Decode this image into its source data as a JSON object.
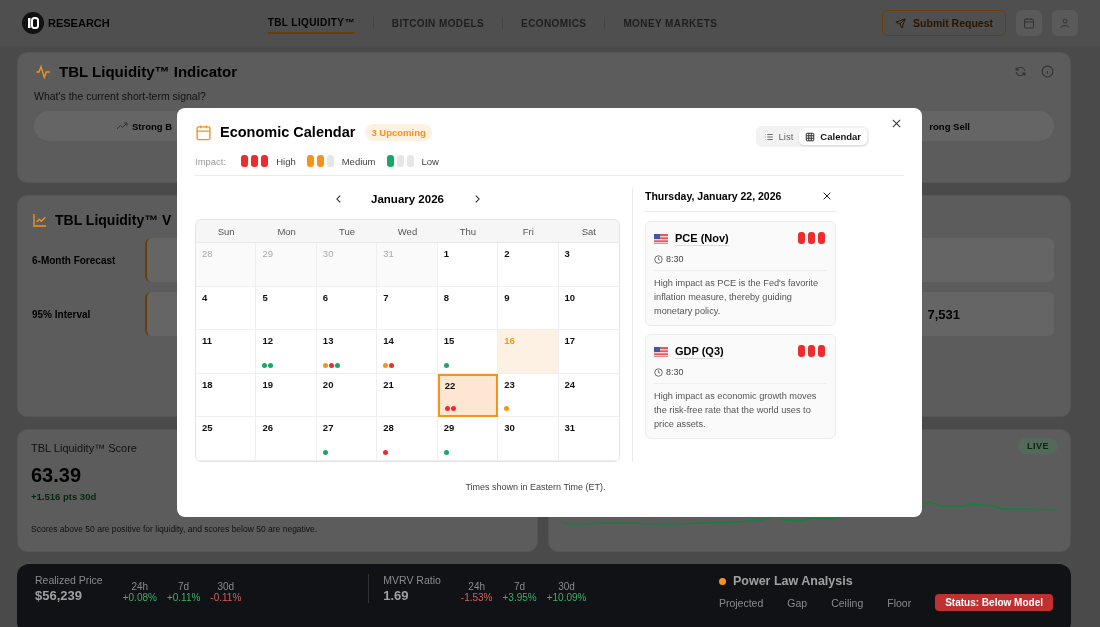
{
  "header": {
    "logo": "RESEARCH",
    "nav": [
      {
        "label": "TBL LIQUIDITY™",
        "selected": true
      },
      {
        "label": "BITCOIN MODELS",
        "selected": false
      },
      {
        "label": "ECONOMICS",
        "selected": false
      },
      {
        "label": "MONEY MARKETS",
        "selected": false
      }
    ],
    "submit": "Submit Request"
  },
  "indicator": {
    "title": "TBL Liquidity™ Indicator",
    "question": "What's the current short-term signal?",
    "signal_left": "Strong B",
    "signal_right": "rong Sell"
  },
  "forecast": {
    "title": "TBL Liquidity™ V",
    "rows": [
      {
        "label": "6-Month Forecast"
      },
      {
        "label": "95% Interval",
        "value": "7,531"
      }
    ]
  },
  "score": {
    "title": "TBL Liquidity™ Score",
    "value": "63.39",
    "change": "+1.516 pts 30d",
    "note": "Scores above 50 are positive for liquidity, and scores below 50 are negative."
  },
  "live": {
    "badge": "LIVE"
  },
  "metrics": [
    {
      "label": "Realized Price",
      "value": "$56,239",
      "periods": [
        {
          "label": "24h",
          "change": "+0.08%",
          "kind": "up"
        },
        {
          "label": "7d",
          "change": "+0.11%",
          "kind": "up"
        },
        {
          "label": "30d",
          "change": "-0.11%",
          "kind": "down"
        }
      ]
    },
    {
      "label": "MVRV Ratio",
      "value": "1.69",
      "periods": [
        {
          "label": "24h",
          "change": "-1.53%",
          "kind": "down"
        },
        {
          "label": "7d",
          "change": "+3.95%",
          "kind": "up"
        },
        {
          "label": "30d",
          "change": "+10.09%",
          "kind": "up"
        }
      ]
    }
  ],
  "power_law": {
    "title": "Power Law Analysis",
    "columns": [
      "Projected",
      "Gap",
      "Ceiling",
      "Floor"
    ],
    "status": "Status: Below Model"
  },
  "calendar_modal": {
    "title": "Economic Calendar",
    "badge": "3 Upcoming",
    "views": [
      {
        "label": "List",
        "selected": false
      },
      {
        "label": "Calendar",
        "selected": true
      }
    ],
    "impact_label": "Impact:",
    "legend": [
      {
        "kind": "high",
        "label": "High",
        "color": "#ef2b2d"
      },
      {
        "kind": "medium",
        "label": "Medium",
        "color": "#f7931a"
      },
      {
        "kind": "low",
        "label": "Low",
        "color": "#16a864"
      }
    ],
    "month": "January 2026",
    "weekdays": [
      "Sun",
      "Mon",
      "Tue",
      "Wed",
      "Thu",
      "Fri",
      "Sat"
    ],
    "weeks": [
      [
        {
          "day": "28",
          "outside": true,
          "today": false,
          "selected": false
        },
        {
          "day": "29",
          "outside": true,
          "today": false,
          "selected": false
        },
        {
          "day": "30",
          "outside": true,
          "today": false,
          "selected": false
        },
        {
          "day": "31",
          "outside": true,
          "today": false,
          "selected": false
        },
        {
          "day": "1",
          "outside": false,
          "today": false,
          "selected": false
        },
        {
          "day": "2",
          "outside": false,
          "today": false,
          "selected": false
        },
        {
          "day": "3",
          "outside": false,
          "today": false,
          "selected": false
        }
      ],
      [
        {
          "day": "4",
          "outside": false,
          "today": false,
          "selected": false
        },
        {
          "day": "5",
          "outside": false,
          "today": false,
          "selected": false
        },
        {
          "day": "6",
          "outside": false,
          "today": false,
          "selected": false
        },
        {
          "day": "7",
          "outside": false,
          "today": false,
          "selected": false
        },
        {
          "day": "8",
          "outside": false,
          "today": false,
          "selected": false
        },
        {
          "day": "9",
          "outside": false,
          "today": false,
          "selected": false
        },
        {
          "day": "10",
          "outside": false,
          "today": false,
          "selected": false
        }
      ],
      [
        {
          "day": "11",
          "outside": false,
          "today": false,
          "selected": false
        },
        {
          "day": "12",
          "outside": false,
          "today": false,
          "selected": false,
          "dots": [
            {
              "color": "#16a864"
            },
            {
              "color": "#16a864"
            }
          ]
        },
        {
          "day": "13",
          "outside": false,
          "today": false,
          "selected": false,
          "dots": [
            {
              "color": "#f7931a"
            },
            {
              "color": "#ef2b2d"
            },
            {
              "color": "#16a864"
            }
          ]
        },
        {
          "day": "14",
          "outside": false,
          "today": false,
          "selected": false,
          "dots": [
            {
              "color": "#f7931a"
            },
            {
              "color": "#ef2b2d"
            }
          ]
        },
        {
          "day": "15",
          "outside": false,
          "today": false,
          "selected": false,
          "dots": [
            {
              "color": "#16a864"
            }
          ]
        },
        {
          "day": "16",
          "outside": false,
          "today": true,
          "selected": false
        },
        {
          "day": "17",
          "outside": false,
          "today": false,
          "selected": false
        }
      ],
      [
        {
          "day": "18",
          "outside": false,
          "today": false,
          "selected": false
        },
        {
          "day": "19",
          "outside": false,
          "today": false,
          "selected": false
        },
        {
          "day": "20",
          "outside": false,
          "today": false,
          "selected": false
        },
        {
          "day": "21",
          "outside": false,
          "today": false,
          "selected": false
        },
        {
          "day": "22",
          "outside": false,
          "today": false,
          "selected": true,
          "dots": [
            {
              "color": "#ef2b2d"
            },
            {
              "color": "#ef2b2d"
            }
          ]
        },
        {
          "day": "23",
          "outside": false,
          "today": false,
          "selected": false,
          "dots": [
            {
              "color": "#f7931a"
            }
          ]
        },
        {
          "day": "24",
          "outside": false,
          "today": false,
          "selected": false
        }
      ],
      [
        {
          "day": "25",
          "outside": false,
          "today": false,
          "selected": false
        },
        {
          "day": "26",
          "outside": false,
          "today": false,
          "selected": false
        },
        {
          "day": "27",
          "outside": false,
          "today": false,
          "selected": false,
          "dots": [
            {
              "color": "#16a864"
            }
          ]
        },
        {
          "day": "28",
          "outside": false,
          "today": false,
          "selected": false,
          "dots": [
            {
              "color": "#ef2b2d"
            }
          ]
        },
        {
          "day": "29",
          "outside": false,
          "today": false,
          "selected": false,
          "dots": [
            {
              "color": "#16a864"
            }
          ]
        },
        {
          "day": "30",
          "outside": false,
          "today": false,
          "selected": false
        },
        {
          "day": "31",
          "outside": false,
          "today": false,
          "selected": false
        }
      ]
    ],
    "footer": "Times shown in Eastern Time (ET).",
    "detail": {
      "date": "Thursday, January 22, 2026",
      "events": [
        {
          "name": "PCE (Nov)",
          "kind": "high",
          "time": "8:30",
          "description": "High impact as PCE is the Fed's favorite inflation measure, thereby guiding monetary policy."
        },
        {
          "name": "GDP (Q3)",
          "kind": "high",
          "time": "8:30",
          "description": "High impact as economic growth moves the risk-free rate that the world uses to price assets."
        }
      ]
    }
  }
}
